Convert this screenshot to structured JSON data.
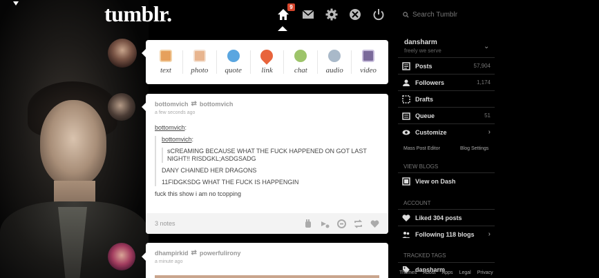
{
  "app": {
    "logo": "tumblr."
  },
  "nav": {
    "badge_count": "9",
    "icons": [
      "home-icon",
      "mail-icon",
      "gear-icon",
      "xkit-icon",
      "power-icon"
    ]
  },
  "search": {
    "placeholder": "Search Tumblr"
  },
  "composer": {
    "types": [
      {
        "label": "text",
        "icon": "text-icon",
        "color": "#e6a05c"
      },
      {
        "label": "photo",
        "icon": "photo-icon",
        "color": "#d98a5c"
      },
      {
        "label": "quote",
        "icon": "quote-icon",
        "color": "#5aa6e0"
      },
      {
        "label": "link",
        "icon": "link-icon",
        "color": "#e8643c"
      },
      {
        "label": "chat",
        "icon": "chat-icon",
        "color": "#9dc46a"
      },
      {
        "label": "audio",
        "icon": "audio-icon",
        "color": "#8a9fb5"
      },
      {
        "label": "video",
        "icon": "video-icon",
        "color": "#7a6a9a"
      }
    ]
  },
  "posts": [
    {
      "author": "bottomvich",
      "reblogged_from": "bottomvich",
      "time": "a few seconds ago",
      "reblogger_link": "bottomvich",
      "quoted_user": "bottomvich",
      "quote_text": "sCREAMING BECAUSE WHAT THE FUCK HAPPENED ON GOT LAST NIGHT!! RISDGKL;ASDGSADG",
      "line2": "DANY CHAINED HER DRAGONS",
      "line3": "11FIDGKSDG WHAT THE FUCK IS HAPPENGIN",
      "comment": "fuck this show i am no tcopping",
      "notes": "3 notes"
    },
    {
      "author": "dhampirkid",
      "reblogged_from": "powerfulirony",
      "time": "a minute ago"
    }
  ],
  "sidebar": {
    "username": "dansharm",
    "tagline": "freely we serve",
    "items": [
      {
        "label": "Posts",
        "count": "57,904",
        "icon": "posts-icon"
      },
      {
        "label": "Followers",
        "count": "1,174",
        "icon": "followers-icon"
      },
      {
        "label": "Drafts",
        "count": "",
        "icon": "drafts-icon"
      },
      {
        "label": "Queue",
        "count": "51",
        "icon": "queue-icon"
      },
      {
        "label": "Customize",
        "count": "",
        "icon": "eye-icon"
      }
    ],
    "mass_post_editor": "Mass Post Editor",
    "blog_settings": "Blog Settings",
    "view_blogs_heading": "VIEW BLOGS",
    "view_on_dash": "View on Dash",
    "account_heading": "ACCOUNT",
    "liked": "Liked 304 posts",
    "following": "Following 118 blogs",
    "tracked_heading": "TRACKED TAGS",
    "tracked_tag": "dansharm",
    "footer": [
      "Themes",
      "About",
      "Apps",
      "Legal",
      "Privacy"
    ]
  }
}
